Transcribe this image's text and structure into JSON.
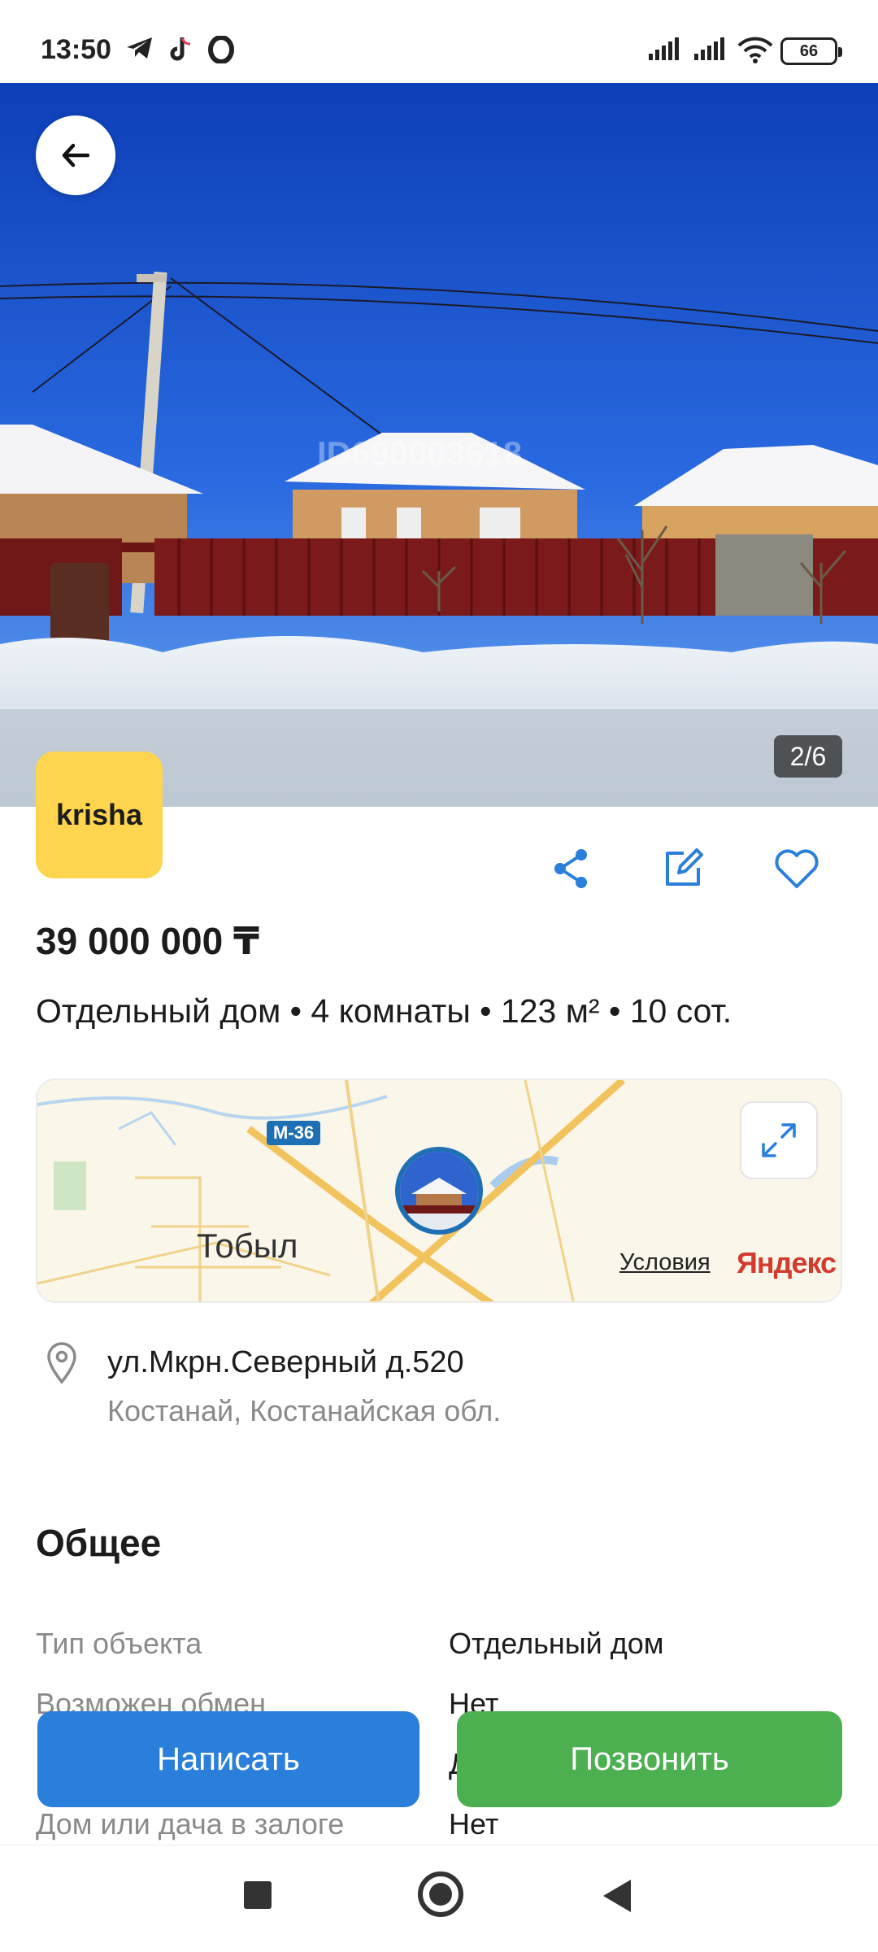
{
  "status": {
    "time": "13:50",
    "battery": "66"
  },
  "photo": {
    "watermark": "ID690003618",
    "counter": "2/6"
  },
  "logo": {
    "text": "krisha"
  },
  "listing": {
    "price": "39 000 000 ₸",
    "summary": "Отдельный дом • 4 комнаты • 123 м² • 10 сот."
  },
  "map": {
    "city": "Тобыл",
    "road": "М-36",
    "terms": "Условия",
    "brand": "Яндекс"
  },
  "address": {
    "street": "ул.Мкрн.Северный д.520",
    "city": "Костанай, Костанайская обл."
  },
  "general": {
    "title": "Общее",
    "rows": [
      {
        "label": "Тип объекта",
        "value": "Отдельный дом"
      },
      {
        "label": "Возможен обмен",
        "value": "Нет"
      },
      {
        "label": "",
        "value": "Д"
      },
      {
        "label": "Дом или дача в залоге",
        "value": "Нет"
      }
    ]
  },
  "buttons": {
    "write": "Написать",
    "call": "Позвонить"
  },
  "colors": {
    "primary": "#2a7fdb",
    "call": "#4caf50",
    "logo": "#ffd54f"
  }
}
